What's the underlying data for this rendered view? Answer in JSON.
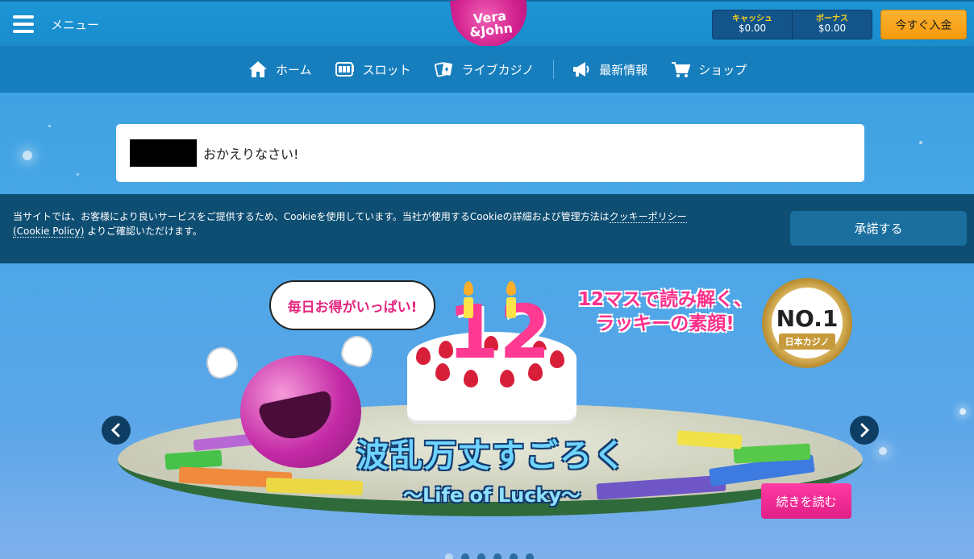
{
  "header": {
    "menu_label": "メニュー",
    "logo_line1": "Vera",
    "logo_line2": "&John",
    "balance": {
      "cash_label": "キャッシュ",
      "cash_value": "$0.00",
      "bonus_label": "ボーナス",
      "bonus_value": "$0.00"
    },
    "deposit_label": "今すぐ入金"
  },
  "nav": {
    "items": [
      {
        "label": "ホーム",
        "icon": "home-icon"
      },
      {
        "label": "スロット",
        "icon": "slot-icon"
      },
      {
        "label": "ライブカジノ",
        "icon": "cards-icon"
      },
      {
        "label": "最新情報",
        "icon": "megaphone-icon"
      },
      {
        "label": "ショップ",
        "icon": "cart-icon"
      }
    ]
  },
  "welcome": {
    "message": "おかえりなさい!"
  },
  "cookie": {
    "text_before": "当サイトでは、お客様により良いサービスをご提供するため、Cookieを使用しています。当社が使用するCookieの詳細および管理方法は",
    "link1": "クッキーポリシー",
    "link2": "(Cookie Policy)",
    "text_after": " よりご確認いただけます。",
    "accept_label": "承諾する"
  },
  "hero": {
    "bubble": "毎日お得がいっぱい!",
    "headline_line1": "12マスで読み解く、",
    "headline_line2": "ラッキーの素顔!",
    "cake_number": "12",
    "badge_top": "NO.1",
    "badge_bottom": "日本カジノ",
    "title": "波乱万丈すごろく",
    "subtitle": "〜Life of Lucky〜",
    "read_more": "続きを読む",
    "slide_count": 6,
    "active_slide": 1
  },
  "colors": {
    "topbar": "#1a8ccc",
    "navbar": "#177ebd",
    "cookie_bg": "#0e4e73",
    "deposit": "#f7a61b",
    "brand_pink": "#d2218f"
  }
}
